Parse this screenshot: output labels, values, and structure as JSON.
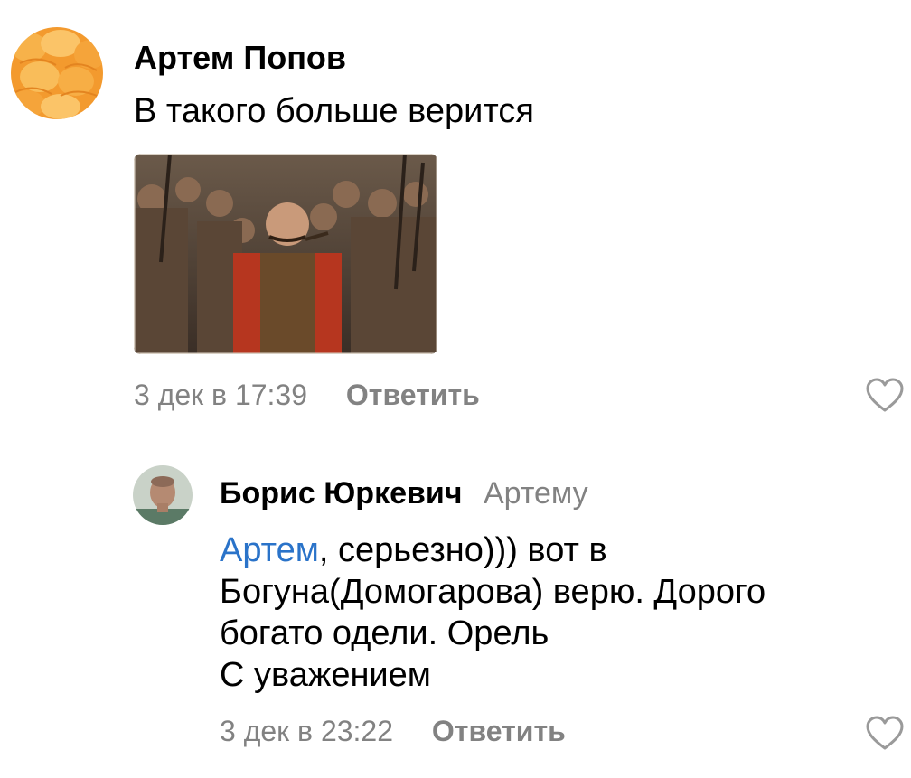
{
  "comments": [
    {
      "author": "Артем Попов",
      "text": "В такого больше верится",
      "date": "3 дек в 17:39",
      "reply_label": "Ответить",
      "like_icon": "heart-outline-icon",
      "avatar": "orange-slices-avatar",
      "attachment": "cossack-movie-still-photo"
    },
    {
      "author": "Борис Юркевич",
      "reply_to": "Артему",
      "mention": "Артем",
      "text_line1_rest": ", серьезно))) вот в",
      "text_line2": "Богуна(Домогарова) верю. Дорого",
      "text_line3": "богато одели. Орель",
      "text_line4": "С уважением",
      "date": "3 дек в 23:22",
      "reply_label": "Ответить",
      "like_icon": "heart-outline-icon",
      "avatar": "man-portrait-avatar"
    }
  ],
  "colors": {
    "link": "#2a73c9",
    "secondary_text": "#828282",
    "primary_text": "#000000"
  }
}
